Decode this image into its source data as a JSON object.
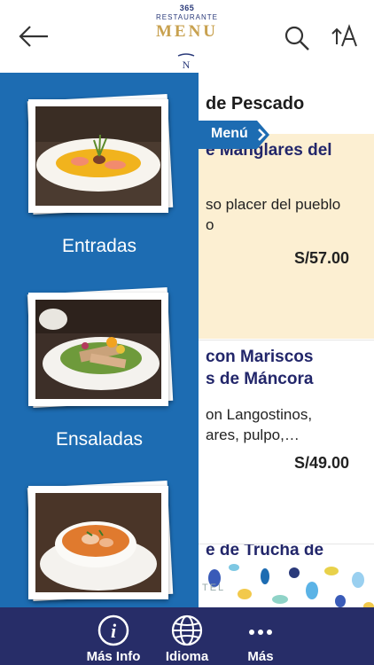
{
  "header": {
    "brand_number": "365",
    "brand_subtitle": "RESTAURANTE",
    "brand_title": "MENU",
    "brand_mark": "N"
  },
  "content": {
    "section_title": "de Pescado",
    "menu_tab_label": "Menú",
    "dishes": [
      {
        "name": "e Manglares del",
        "desc_line1": "so placer del pueblo",
        "desc_line2": "o",
        "price": "S/57.00"
      },
      {
        "name_line1": "con Mariscos",
        "name_line2": "s de Máncora",
        "desc_line1": "on Langostinos,",
        "desc_line2": "ares, pulpo,…",
        "price": "S/49.00"
      },
      {
        "name": "e de Trucha de",
        "partial_text": "TEL"
      }
    ]
  },
  "drawer": {
    "categories": [
      {
        "label": "Entradas"
      },
      {
        "label": "Ensaladas"
      },
      {
        "label": ""
      }
    ]
  },
  "bottom_bar": {
    "items": [
      {
        "label": "Más Info",
        "icon": "info-icon"
      },
      {
        "label": "Idioma",
        "icon": "globe-icon"
      },
      {
        "label": "Más",
        "icon": "more-icon"
      }
    ]
  },
  "colors": {
    "drawer_bg": "#1d6cb2",
    "highlight_row": "#fcefd2",
    "dish_name": "#22266a",
    "bottom_bar": "#272d68",
    "brand_gold": "#c8a14f"
  }
}
